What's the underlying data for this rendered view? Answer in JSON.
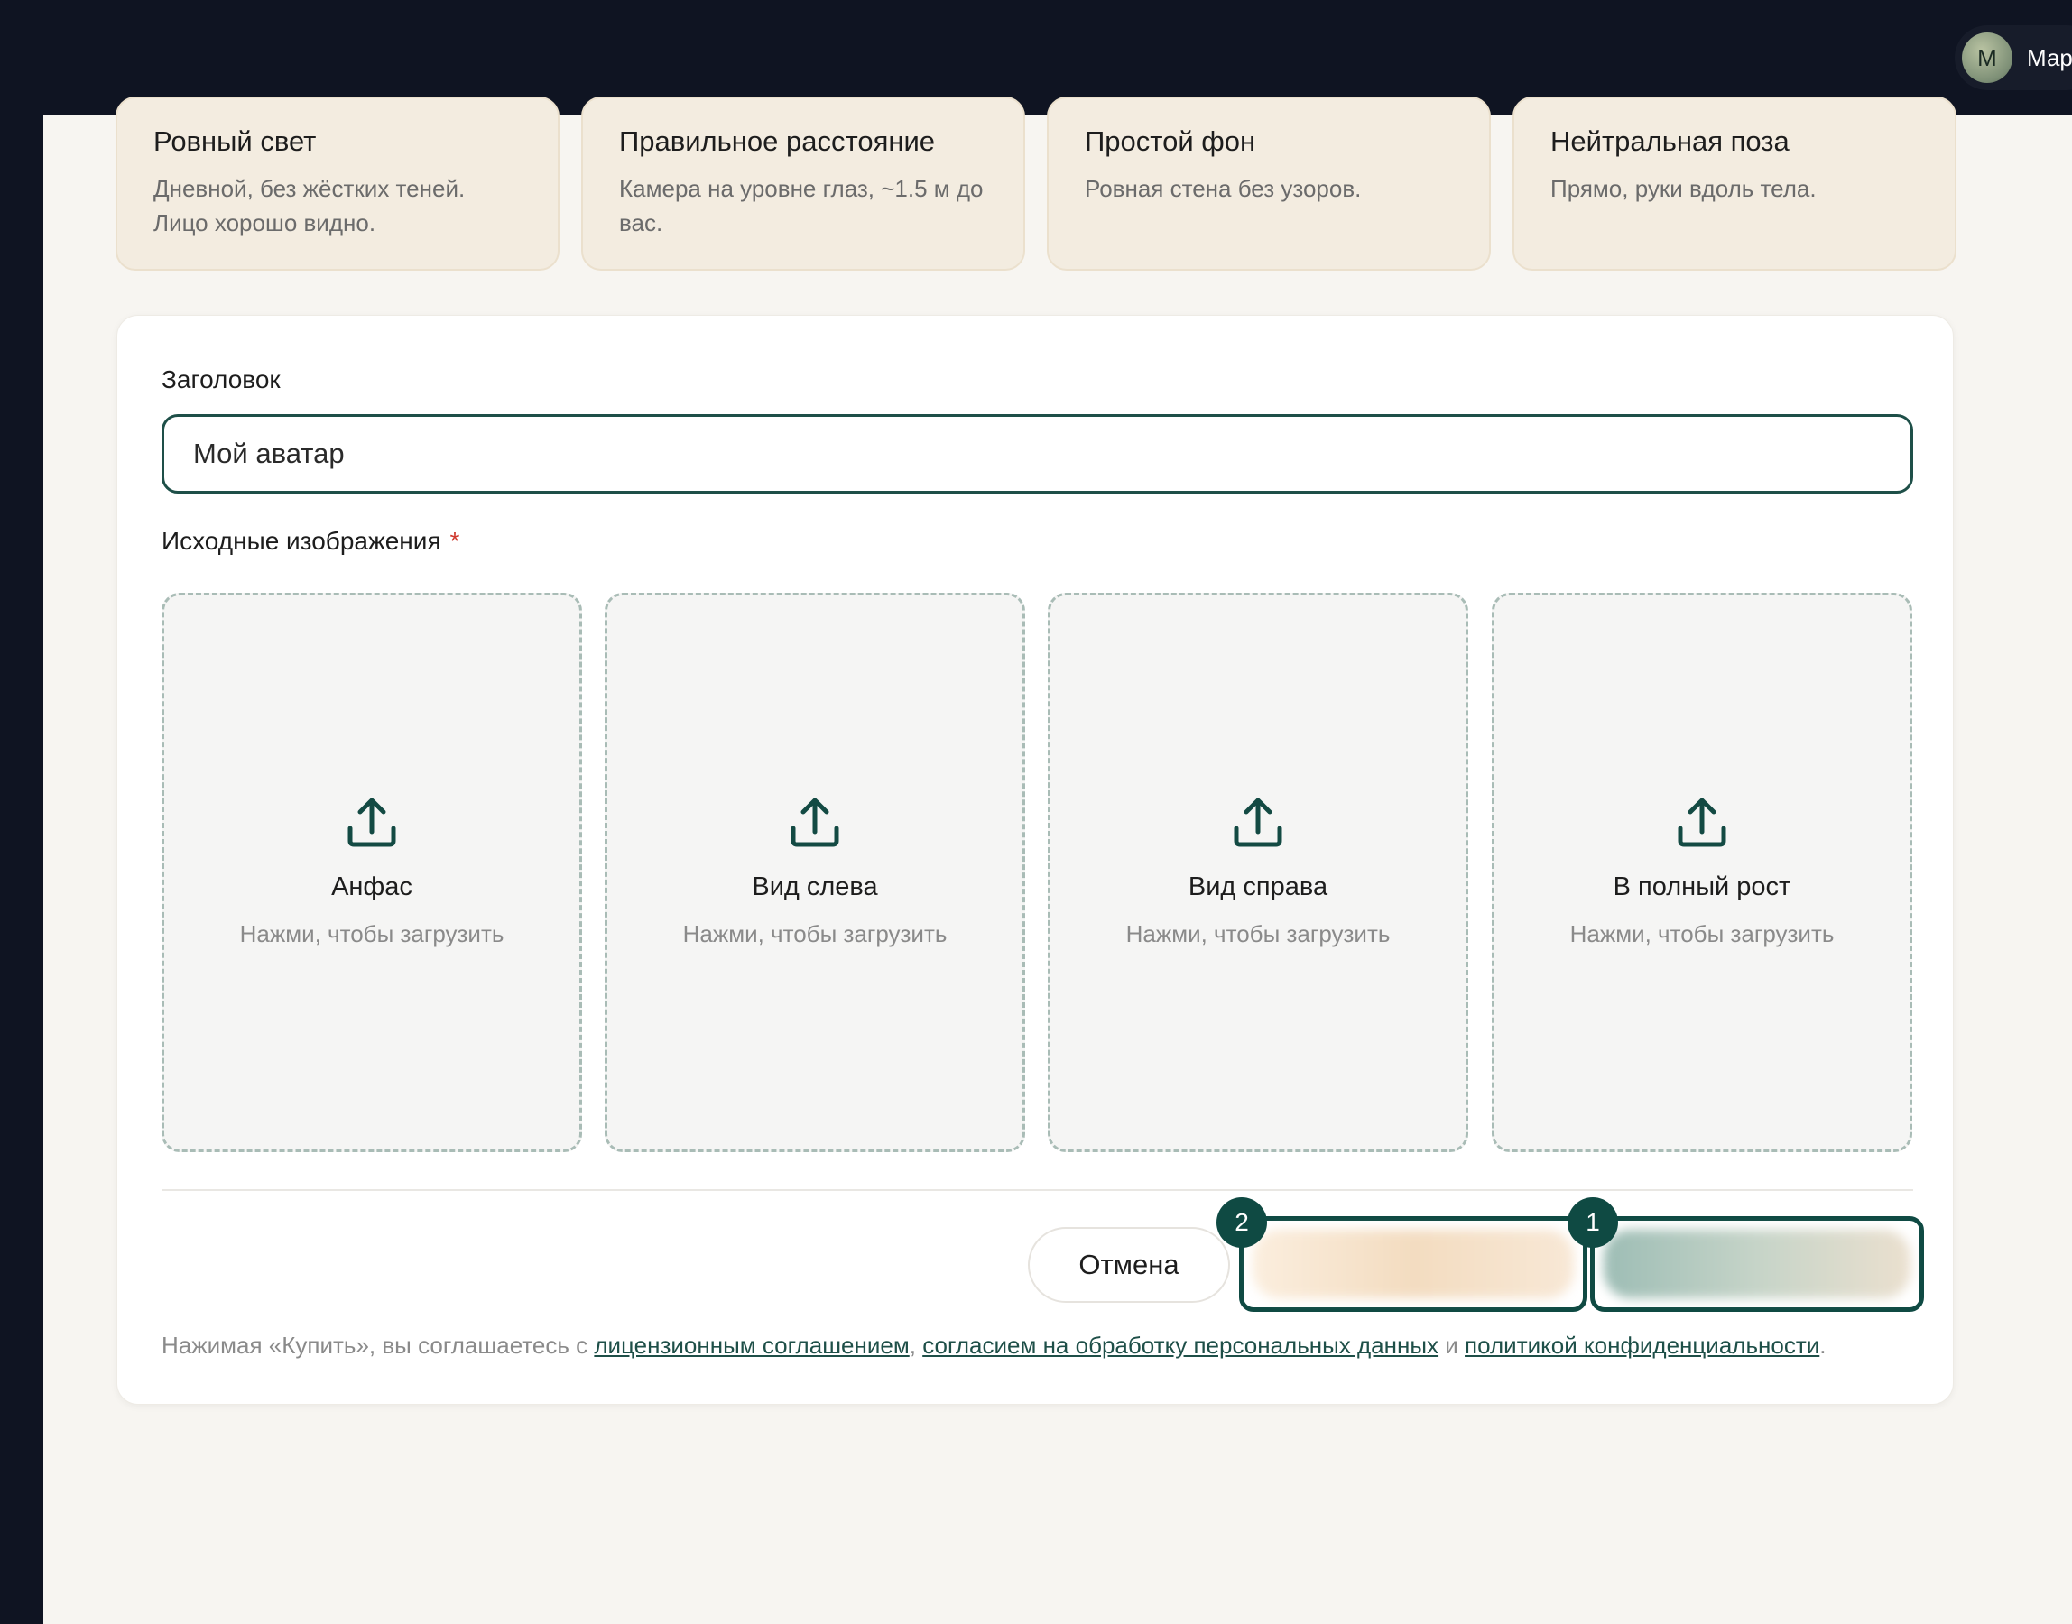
{
  "header": {
    "user_initial": "M",
    "user_name": "Мар"
  },
  "tips": [
    {
      "title": "Ровный свет",
      "text": "Дневной, без жёстких теней. Лицо хорошо видно."
    },
    {
      "title": "Правильное расстояние",
      "text": "Камера на уровне глаз, ~1.5 м до вас."
    },
    {
      "title": "Простой фон",
      "text": "Ровная стена без узоров."
    },
    {
      "title": "Нейтральная поза",
      "text": "Прямо, руки вдоль тела."
    }
  ],
  "form": {
    "title_label": "Заголовок",
    "title_value": "Мой аватар",
    "images_label": "Исходные изображения",
    "required_mark": "*",
    "slots": [
      {
        "title": "Анфас",
        "hint": "Нажми, чтобы загрузить",
        "icon": "upload-icon"
      },
      {
        "title": "Вид слева",
        "hint": "Нажми, чтобы загрузить",
        "icon": "upload-icon"
      },
      {
        "title": "Вид справа",
        "hint": "Нажми, чтобы загрузить",
        "icon": "upload-icon"
      },
      {
        "title": "В полный рост",
        "hint": "Нажми, чтобы загрузить",
        "icon": "upload-icon"
      }
    ]
  },
  "actions": {
    "cancel_label": "Отмена",
    "badge_secondary": "2",
    "badge_primary": "1"
  },
  "legal": {
    "prefix": "Нажимая «Купить», вы соглашаетесь с ",
    "link_license": "лицензионным соглашением",
    "sep1": ", ",
    "link_consent": "согласием на обработку персональных данных",
    "sep2": " и ",
    "link_privacy": "политикой конфиденциальности",
    "suffix": "."
  },
  "colors": {
    "accent": "#0f4a43",
    "topbar": "#0f1422",
    "tip_background": "#f3ece0",
    "required": "#d03a2f"
  }
}
